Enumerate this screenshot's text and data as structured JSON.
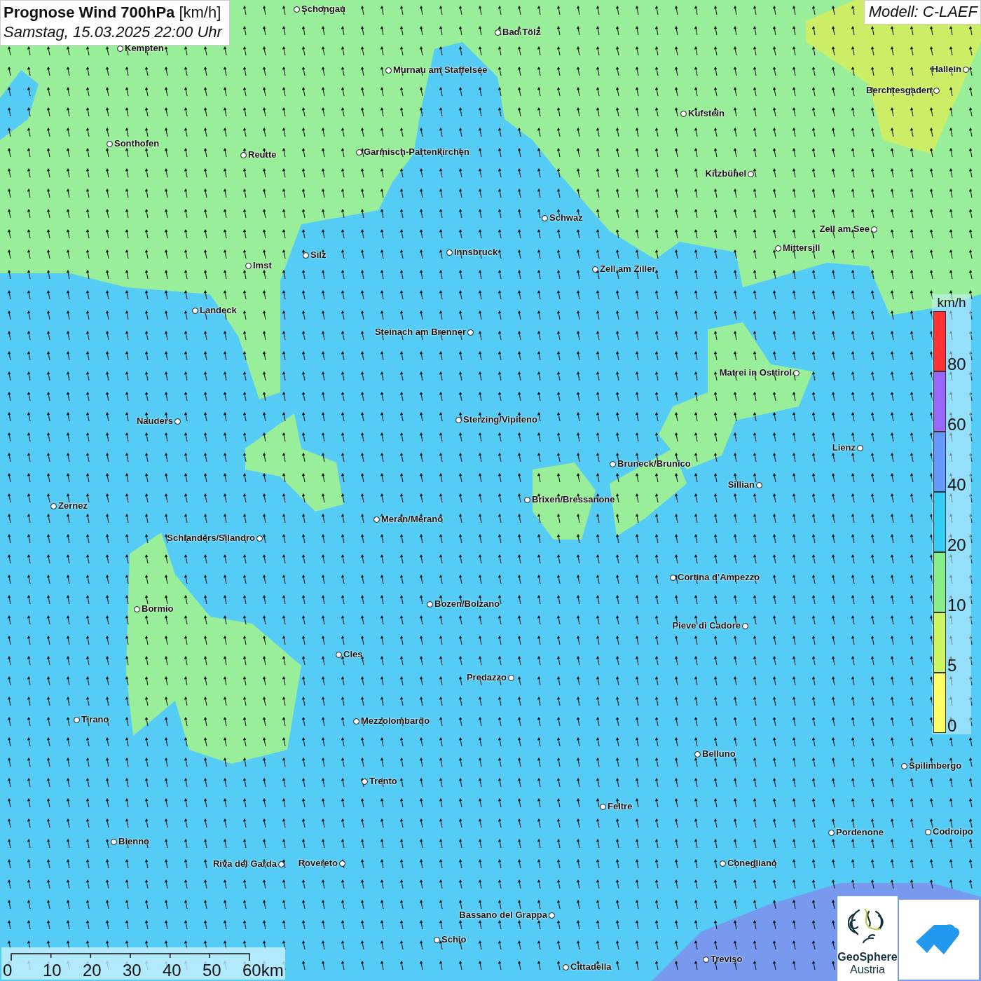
{
  "title": {
    "heading": "**Prognose Wind 700hPa** [km/h]",
    "subtitle": "Samstag, 15.03.2025 22:00 Uhr"
  },
  "model": "Modell: C-LAEF",
  "cities": [
    "Schongau",
    "Bad Tölz",
    "Kempten",
    "Murnau am Staffelsee",
    "Hallein",
    "Berchtesgaden",
    "Kufstein",
    "Sonthofen",
    "Reutte",
    "Garmisch-Partenkirchen",
    "Kitzbühel",
    "Schwaz",
    "Zell am See",
    "Mittersill",
    "Silz",
    "Innsbruck",
    "Imst",
    "Zell am Ziller",
    "Landeck",
    "Steinach am Brenner",
    "Matrei in Osttirol",
    "Nauders",
    "Sterzing/Vipiteno",
    "Lienz",
    "Bruneck/Brunico",
    "Sillian",
    "Brixen/Bressanone",
    "Zernez",
    "Meran/Merano",
    "Schlanders/Silandro",
    "Cortina d'Ampezzo",
    "Bozen/Bolzano",
    "Bormio",
    "Pieve di Cadore",
    "Cles",
    "Predazzo",
    "Tirano",
    "Mezzolombardo",
    "Belluno",
    "Spilimbergo",
    "Trento",
    "Feltre",
    "Pordenone",
    "Codroipo",
    "Bienno",
    "Riva del Garda",
    "Rovereto",
    "Conegliano",
    "Bassano del Grappa",
    "Schio",
    "Treviso",
    "Cittadella"
  ],
  "legend": {
    "unit": "km/h",
    "steps": [
      {
        "label": "80",
        "color": "#ff3333"
      },
      {
        "label": "60",
        "color": "#9966ff"
      },
      {
        "label": "40",
        "color": "#6699ff"
      },
      {
        "label": "20",
        "color": "#33ccf5"
      },
      {
        "label": "10",
        "color": "#88ee88"
      },
      {
        "label": "5",
        "color": "#ccf560"
      },
      {
        "label": "0",
        "color": "#ffff66"
      }
    ]
  },
  "scale_bar": {
    "labels": [
      "0",
      "10",
      "20",
      "30",
      "40",
      "50",
      "60km"
    ]
  },
  "logos": {
    "geosphere": [
      "GeoSphere",
      "Austria"
    ]
  }
}
